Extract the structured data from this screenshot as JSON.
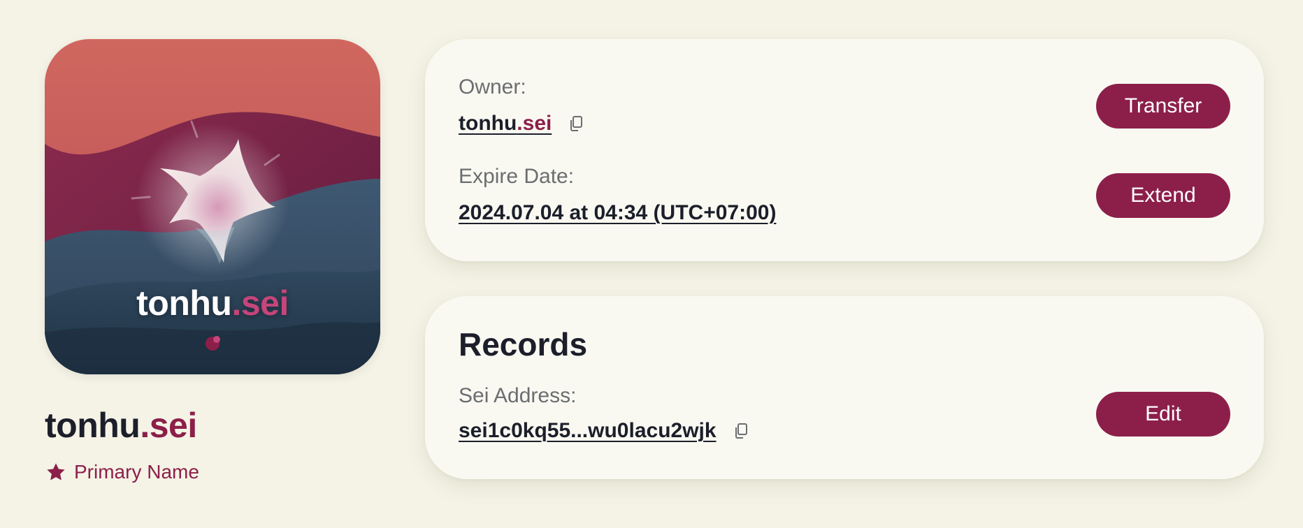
{
  "nft": {
    "base": "tonhu",
    "tld": ".sei"
  },
  "profile": {
    "name_base": "tonhu",
    "name_tld": ".sei",
    "primary_label": "Primary Name",
    "primary_icon": "star-icon"
  },
  "owner_card": {
    "owner_label": "Owner:",
    "owner_base": "tonhu",
    "owner_tld": ".sei",
    "expire_label": "Expire Date:",
    "expire_value": "2024.07.04 at 04:34 (UTC+07:00)",
    "transfer_button": "Transfer",
    "extend_button": "Extend",
    "copy_icon": "copy-icon"
  },
  "records_card": {
    "heading": "Records",
    "address_label": "Sei Address:",
    "address_value": "sei1c0kq55...wu0lacu2wjk",
    "edit_button": "Edit"
  },
  "colors": {
    "background": "#f4f3e6",
    "card": "#f9f9f2",
    "accent": "#8c1f4a",
    "text": "#1c1f2a",
    "muted": "#6b6d70"
  }
}
